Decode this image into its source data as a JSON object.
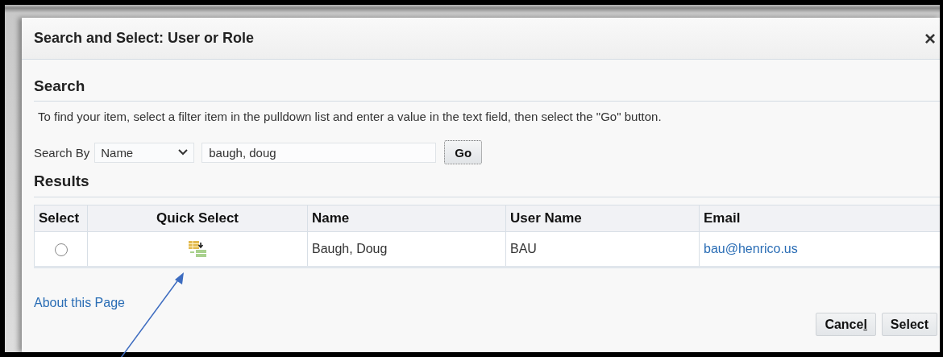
{
  "dialog": {
    "title": "Search and Select: User or Role",
    "close": "×"
  },
  "search": {
    "heading": "Search",
    "instructions": "To find your item, select a filter item in the pulldown list and enter a value in the text field, then select the \"Go\" button.",
    "label": "Search By",
    "filter": "Name",
    "value": "baugh, doug",
    "go": "Go"
  },
  "results": {
    "heading": "Results",
    "columns": [
      "Select",
      "Quick Select",
      "Name",
      "User Name",
      "Email"
    ],
    "rows": [
      {
        "selected": false,
        "name": "Baugh, Doug",
        "user_name": "BAU",
        "email": "bau@henrico.us"
      }
    ]
  },
  "about_link": "About this Page",
  "buttons": [
    {
      "label": "Cance",
      "mnemonic": "l"
    },
    {
      "label": "Select"
    }
  ]
}
